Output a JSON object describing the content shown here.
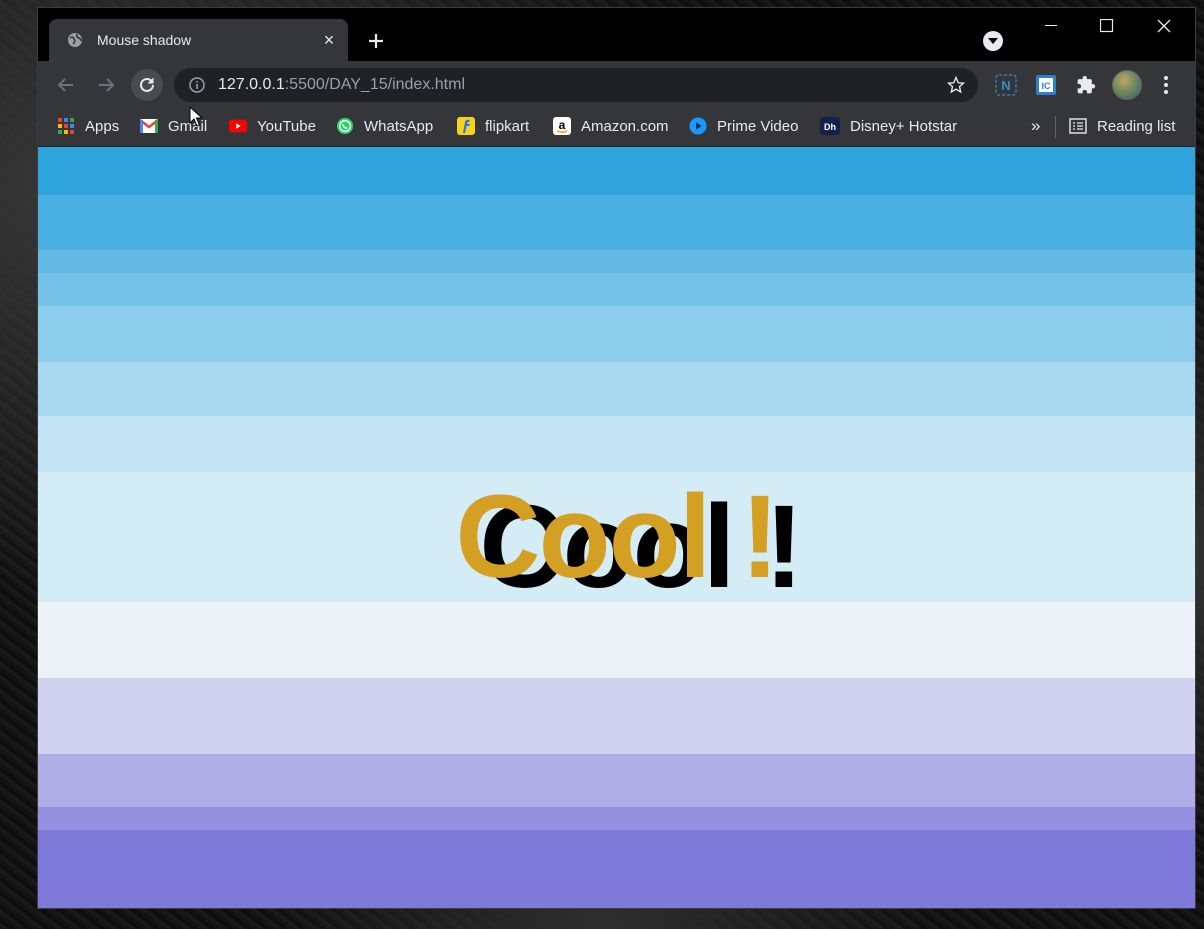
{
  "browser": {
    "tab": {
      "title": "Mouse shadow",
      "favicon": "globe-icon",
      "close": "×"
    },
    "new_tab": "+",
    "url": {
      "host": "127.0.0.1",
      "rest": ":5500/DAY_15/index.html"
    },
    "bookmarks": [
      {
        "label": "Apps",
        "icon": "apps-grid-icon"
      },
      {
        "label": "Gmail",
        "icon": "gmail-icon"
      },
      {
        "label": "YouTube",
        "icon": "youtube-icon"
      },
      {
        "label": "WhatsApp",
        "icon": "whatsapp-icon"
      },
      {
        "label": "flipkart",
        "icon": "flipkart-icon"
      },
      {
        "label": "Amazon.com",
        "icon": "amazon-icon"
      },
      {
        "label": "Prime Video",
        "icon": "prime-video-icon"
      },
      {
        "label": "Disney+ Hotstar",
        "icon": "hotstar-icon"
      }
    ],
    "overflow": "»",
    "reading_list": "Reading list"
  },
  "page": {
    "heading": "Cool !",
    "heading_color": "#d4a024",
    "shadow_color": "#000000",
    "band_colors": [
      "#2fa3dc",
      "#4aafe1",
      "#62b9e4",
      "#74c2e7",
      "#8ccdeb",
      "#a8d9f0",
      "#c2e4f4",
      "#d4ecf6",
      "#edf2f9",
      "#d1d1f0",
      "#b0aee6",
      "#9590df",
      "#7f79da",
      "#6f6cd6"
    ]
  },
  "colors": {
    "tab_active": "#35363a",
    "tabstrip": "#000000",
    "toolbar": "#35363a",
    "omnibox": "#202124"
  }
}
